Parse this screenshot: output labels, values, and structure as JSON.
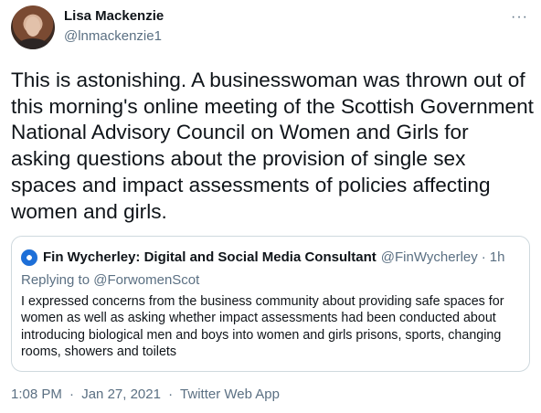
{
  "author": {
    "display_name": "Lisa Mackenzie",
    "handle": "@lnmackenzie1"
  },
  "more_menu": "···",
  "tweet_text": "This is astonishing. A businesswoman was thrown out of this morning's online meeting of the Scottish Government National Advisory Council on Women and Girls for asking questions about the provision of single sex spaces and impact assessments of policies affecting women and girls.",
  "quoted_tweet": {
    "display_name": "Fin Wycherley: Digital and Social Media Consultant",
    "handle": "@FinWycherley",
    "separator": "·",
    "time": "1h",
    "replying_to_label": "Replying to",
    "replying_to_handle": "@ForwomenScot",
    "text": "I expressed concerns from the business community about providing safe spaces for women as well as asking whether  impact assessments had been conducted about introducing biological men and boys into women and girls prisons, sports, changing rooms, showers and toilets"
  },
  "meta": {
    "time": "1:08 PM",
    "separator": "·",
    "date": "Jan 27, 2021",
    "source": "Twitter Web App"
  }
}
